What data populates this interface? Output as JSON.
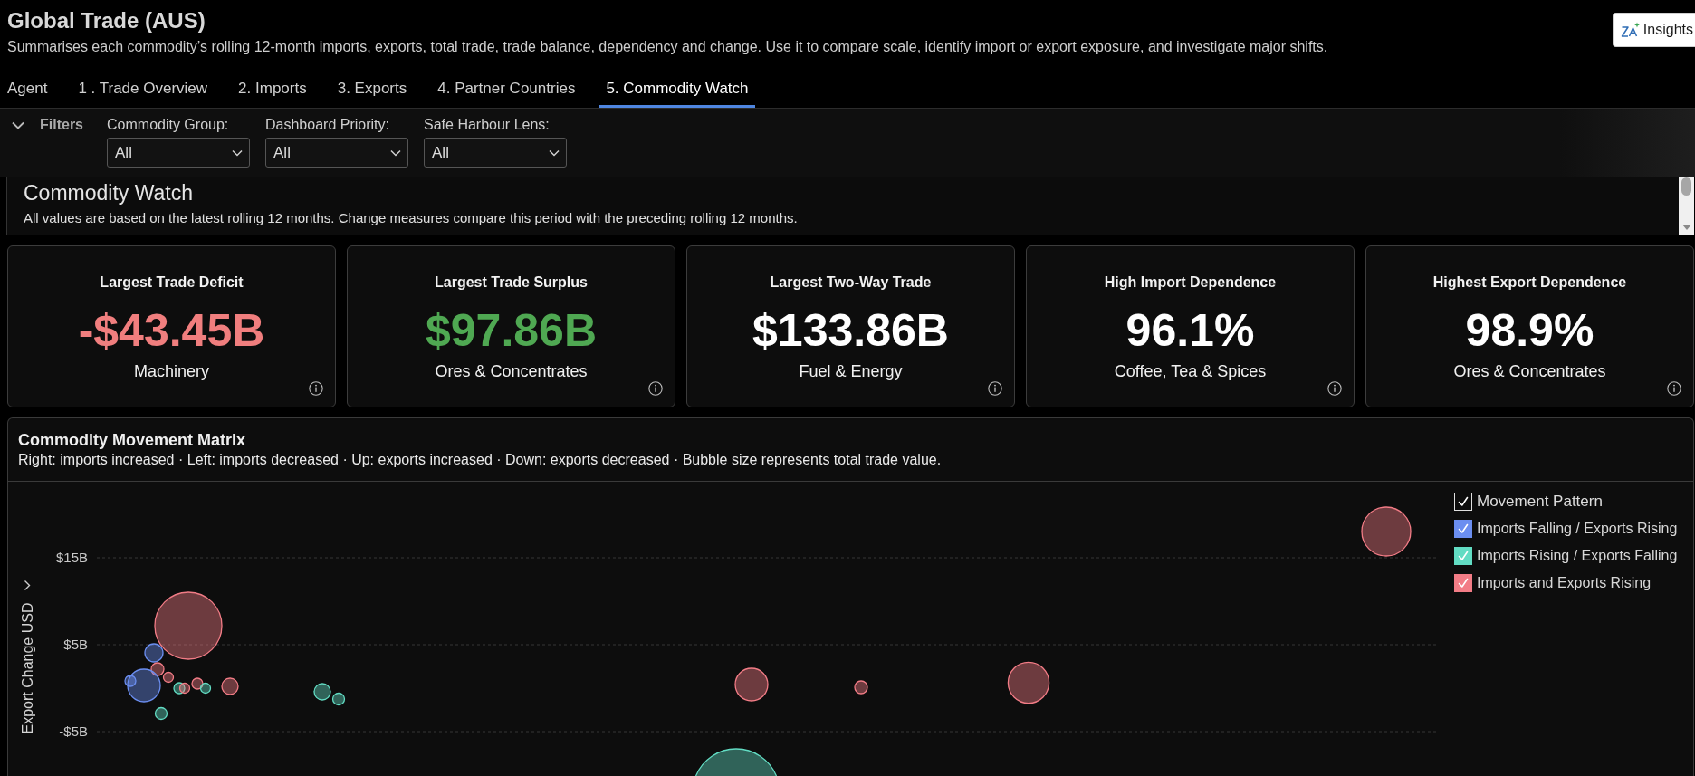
{
  "header": {
    "title": "Global Trade (AUS)",
    "subtitle": "Summarises each commodity’s rolling 12-month imports, exports, total trade, trade balance, dependency and change. Use it to compare scale, identify import or export exposure, and investigate major shifts.",
    "insights_button": "Insights"
  },
  "tabs": [
    {
      "label": "Agent",
      "selected": false
    },
    {
      "label": "1 . Trade Overview",
      "selected": false
    },
    {
      "label": "2. Imports",
      "selected": false
    },
    {
      "label": "3. Exports",
      "selected": false
    },
    {
      "label": "4. Partner Countries",
      "selected": false
    },
    {
      "label": "5. Commodity Watch",
      "selected": true
    }
  ],
  "filters": {
    "toggle": "Filters",
    "expanded": true,
    "fields": [
      {
        "label": "Commodity Group:",
        "value": "All"
      },
      {
        "label": "Dashboard Priority:",
        "value": "All"
      },
      {
        "label": "Safe Harbour Lens:",
        "value": "All"
      }
    ]
  },
  "section": {
    "title": "Commodity Watch",
    "description": "All values are based on the latest rolling 12 months. Change measures compare this period with the preceding rolling 12 months."
  },
  "kpis": [
    {
      "title": "Largest Trade Deficit",
      "value": "-$43.45B",
      "subtitle": "Machinery",
      "color": "#f07e7e"
    },
    {
      "title": "Largest Trade Surplus",
      "value": "$97.86B",
      "subtitle": "Ores & Concentrates",
      "color": "#4fa852"
    },
    {
      "title": "Largest Two-Way Trade",
      "value": "$133.86B",
      "subtitle": "Fuel & Energy",
      "color": "#ffffff"
    },
    {
      "title": "High Import Dependence",
      "value": "96.1%",
      "subtitle": "Coffee, Tea & Spices",
      "color": "#ffffff"
    },
    {
      "title": "Highest Export Dependence",
      "value": "98.9%",
      "subtitle": "Ores & Concentrates",
      "color": "#ffffff"
    }
  ],
  "matrix": {
    "title": "Commodity Movement Matrix",
    "subtitle": "Right: imports increased · Left: imports decreased · Up: exports increased · Down: exports decreased · Bubble size represents total trade value.",
    "y_axis": {
      "title": "Export Change USD",
      "ticks": [
        "$15B",
        "$5B",
        "-$5B"
      ]
    },
    "legend": {
      "title": "Movement Pattern",
      "checked": true,
      "items": [
        {
          "label": "Imports Falling / Exports Rising",
          "color": "#6b8ef0",
          "checked": true
        },
        {
          "label": "Imports Rising / Exports Falling",
          "color": "#62dcc3",
          "checked": true
        },
        {
          "label": "Imports and Exports Rising",
          "color": "#f27c86",
          "checked": true
        }
      ]
    }
  }
}
